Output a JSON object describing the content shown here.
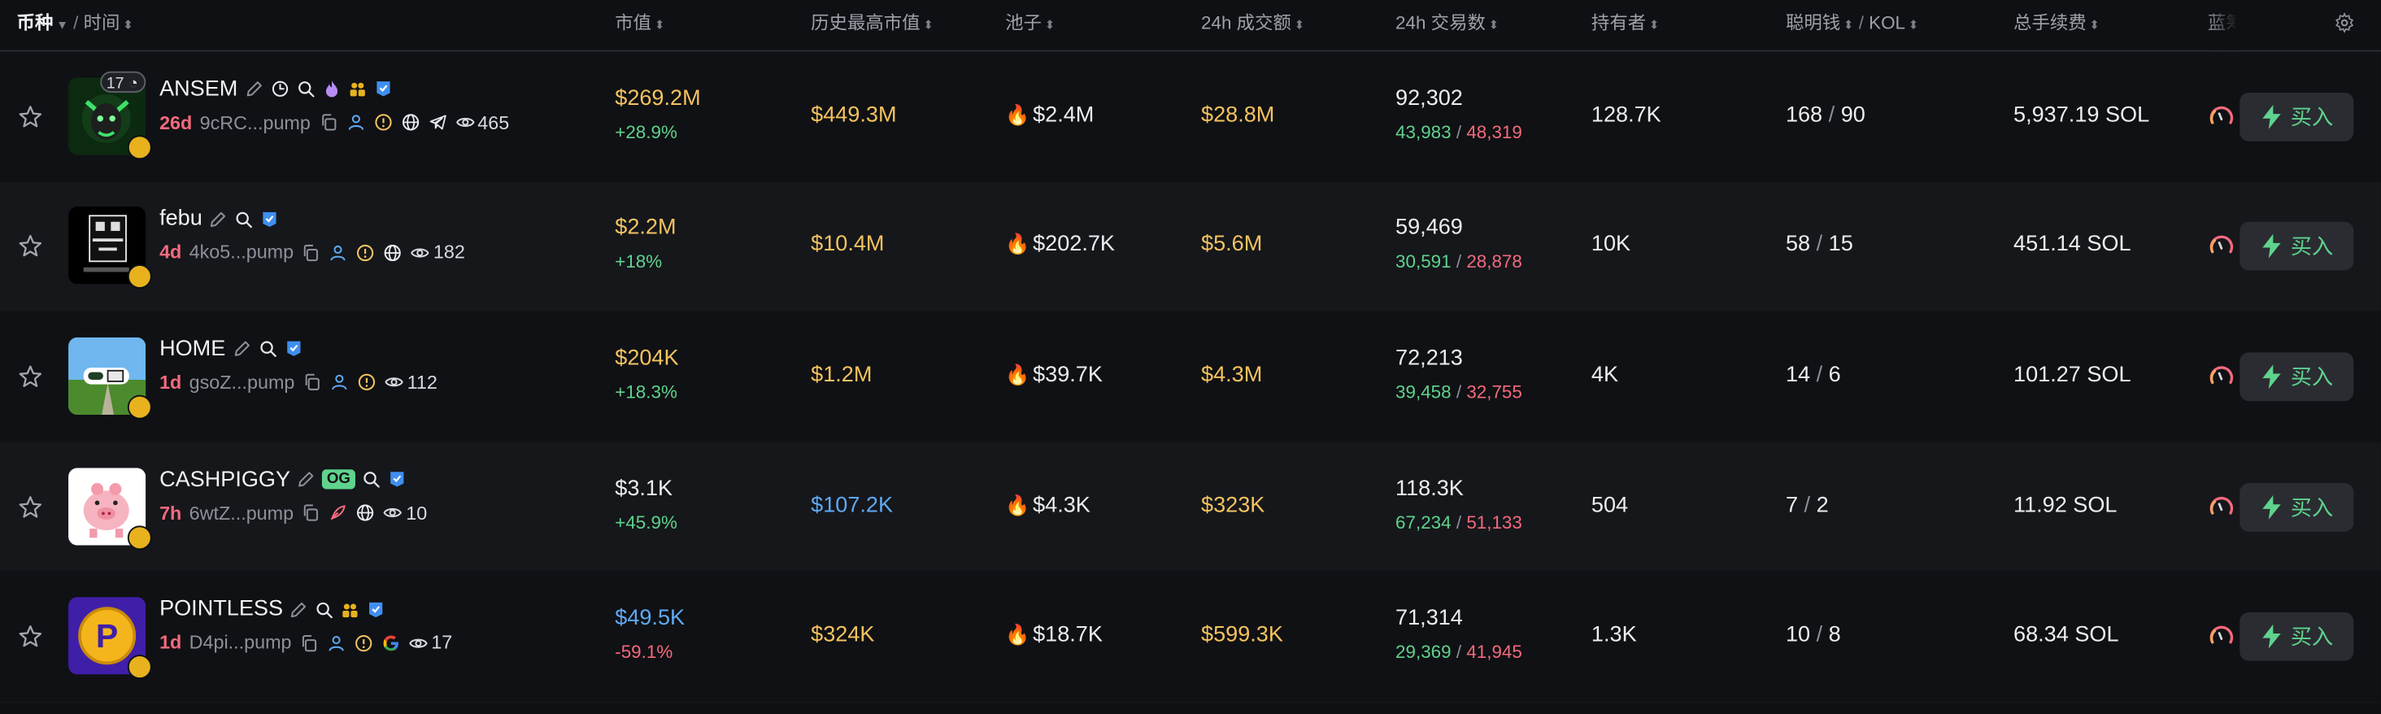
{
  "header": {
    "coin": "币种",
    "sep": "/",
    "time": "时间",
    "mcap": "市值",
    "ath_mcap": "历史最高市值",
    "pool": "池子",
    "vol24": "24h 成交额",
    "tx24": "24h 交易数",
    "holders": "持有者",
    "smart": "聪明钱",
    "kol": "KOL",
    "fees": "总手续费",
    "bluechip": "蓝筹"
  },
  "buy_label": "买入",
  "colors": {
    "gold": "#f4c35f",
    "blue": "#5fa9f4",
    "green": "#5fd38d",
    "red": "#f46a7d"
  },
  "rows": [
    {
      "symbol": "ANSEM",
      "age": "26d",
      "addr": "9cRC...pump",
      "views": "465",
      "badge_count": "17",
      "mcap": "$269.2M",
      "mcap_color": "gold",
      "change": "+28.9%",
      "change_color": "green",
      "ath": "$449.3M",
      "ath_color": "gold",
      "pool": "$2.4M",
      "vol": "$28.8M",
      "tx_total": "92,302",
      "tx_buy": "43,983",
      "tx_sell": "48,319",
      "holders": "128.7K",
      "smart": "168",
      "kol": "90",
      "fees": "5,937.19 SOL"
    },
    {
      "symbol": "febu",
      "age": "4d",
      "addr": "4ko5...pump",
      "views": "182",
      "mcap": "$2.2M",
      "mcap_color": "gold",
      "change": "+18%",
      "change_color": "green",
      "ath": "$10.4M",
      "ath_color": "gold",
      "pool": "$202.7K",
      "vol": "$5.6M",
      "tx_total": "59,469",
      "tx_buy": "30,591",
      "tx_sell": "28,878",
      "holders": "10K",
      "smart": "58",
      "kol": "15",
      "fees": "451.14 SOL"
    },
    {
      "symbol": "HOME",
      "age": "1d",
      "addr": "gsoZ...pump",
      "views": "112",
      "mcap": "$204K",
      "mcap_color": "gold",
      "change": "+18.3%",
      "change_color": "green",
      "ath": "$1.2M",
      "ath_color": "gold",
      "pool": "$39.7K",
      "vol": "$4.3M",
      "tx_total": "72,213",
      "tx_buy": "39,458",
      "tx_sell": "32,755",
      "holders": "4K",
      "smart": "14",
      "kol": "6",
      "fees": "101.27 SOL"
    },
    {
      "symbol": "CASHPIGGY",
      "og": "OG",
      "age": "7h",
      "addr": "6wtZ...pump",
      "views": "10",
      "mcap": "$3.1K",
      "mcap_color": "white",
      "change": "+45.9%",
      "change_color": "green",
      "ath": "$107.2K",
      "ath_color": "blue",
      "pool": "$4.3K",
      "vol": "$323K",
      "tx_total": "118.3K",
      "tx_buy": "67,234",
      "tx_sell": "51,133",
      "holders": "504",
      "smart": "7",
      "kol": "2",
      "fees": "11.92 SOL"
    },
    {
      "symbol": "POINTLESS",
      "age": "1d",
      "addr": "D4pi...pump",
      "views": "17",
      "avatar_letter": "P",
      "mcap": "$49.5K",
      "mcap_color": "blue",
      "change": "-59.1%",
      "change_color": "red",
      "ath": "$324K",
      "ath_color": "gold",
      "pool": "$18.7K",
      "vol": "$599.3K",
      "tx_total": "71,314",
      "tx_buy": "29,369",
      "tx_sell": "41,945",
      "holders": "1.3K",
      "smart": "10",
      "kol": "8",
      "fees": "68.34 SOL"
    }
  ]
}
